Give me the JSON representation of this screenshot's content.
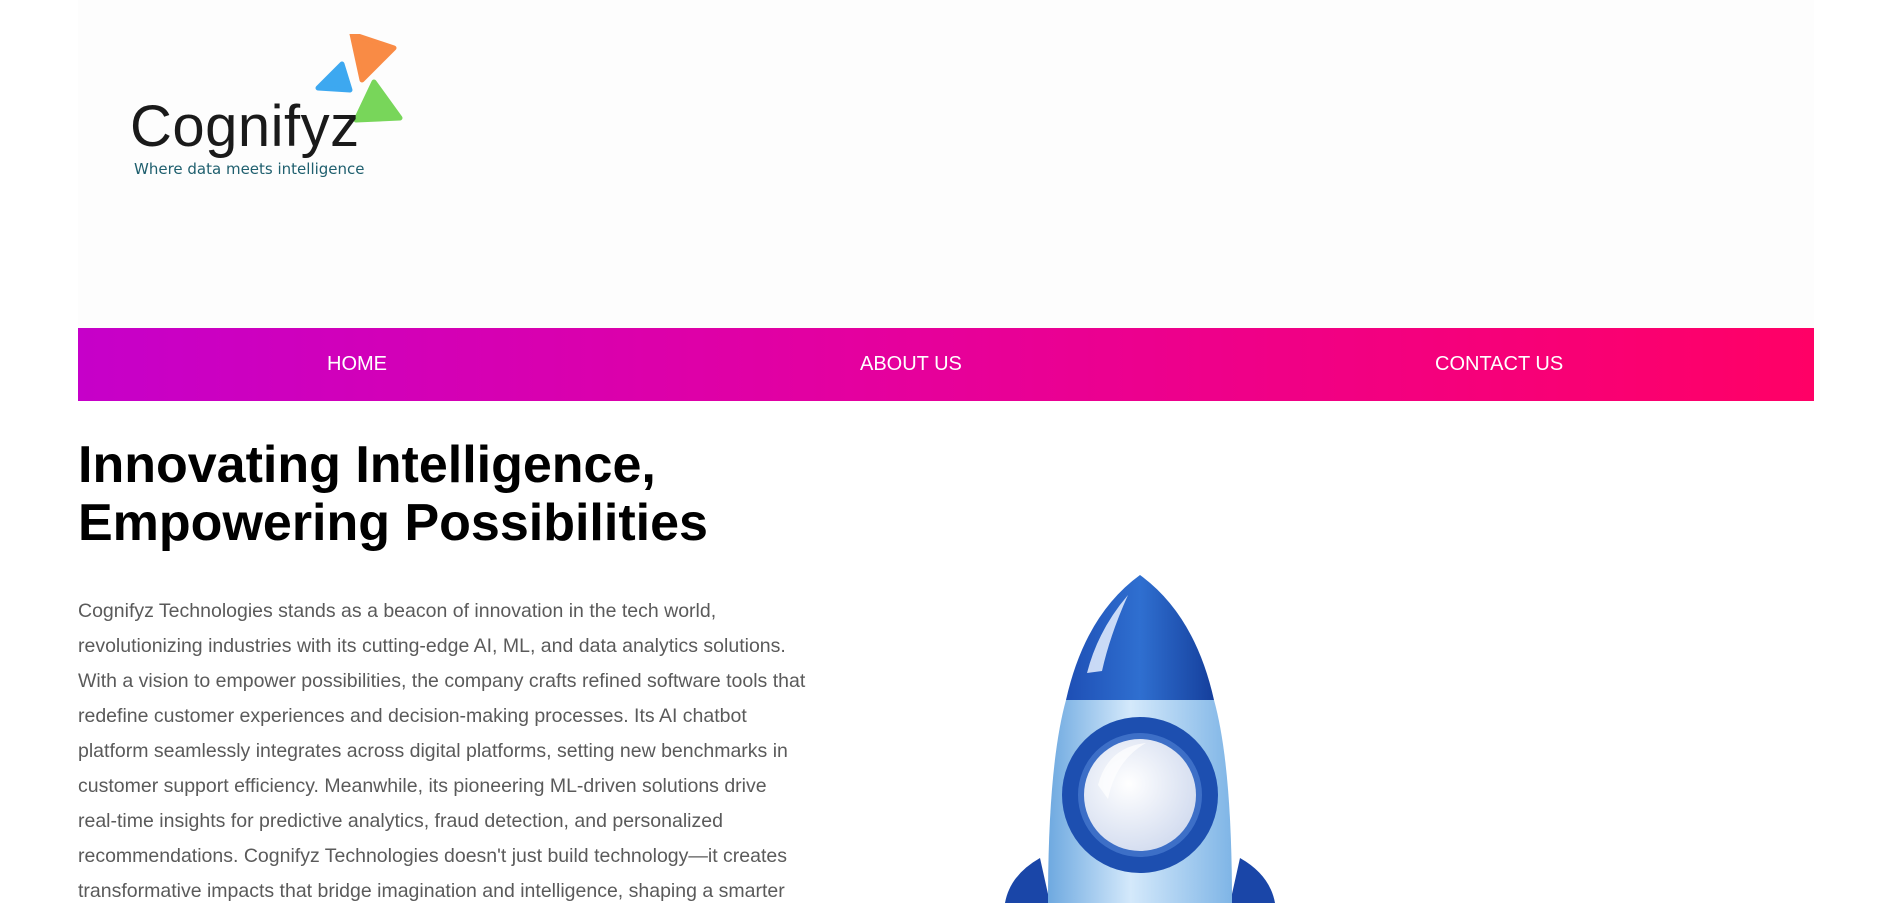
{
  "header": {
    "logo": {
      "name": "Cognifyz",
      "tagline": "Where data meets intelligence",
      "colors": {
        "orange": "#f98b45",
        "blue": "#3da8f0",
        "green": "#78d65a",
        "text": "#1a1a1a",
        "tagline": "#1f5f6e"
      }
    }
  },
  "nav": {
    "gradient": [
      "#c600c9",
      "#ff0066"
    ],
    "items": [
      {
        "label": "HOME"
      },
      {
        "label": "ABOUT US"
      },
      {
        "label": "CONTACT US"
      }
    ]
  },
  "hero": {
    "title_line1": "Innovating Intelligence,",
    "title_line2": "Empowering Possibilities",
    "text_lines": [
      "Cognifyz Technologies stands as a beacon of innovation in the tech world,",
      "revolutionizing industries with its cutting-edge AI, ML, and data analytics solutions.",
      "With a vision to empower possibilities, the company crafts refined software tools that",
      "redefine customer experiences and decision-making processes. Its AI chatbot",
      "platform seamlessly integrates across digital platforms, setting new benchmarks in",
      "customer support efficiency. Meanwhile, its pioneering ML-driven solutions drive",
      "real-time insights for predictive analytics, fraud detection, and personalized",
      "recommendations. Cognifyz Technologies doesn't just build technology—it creates",
      "transformative impacts that bridge imagination and intelligence, shaping a smarter"
    ],
    "illustration": "rocket-icon"
  }
}
